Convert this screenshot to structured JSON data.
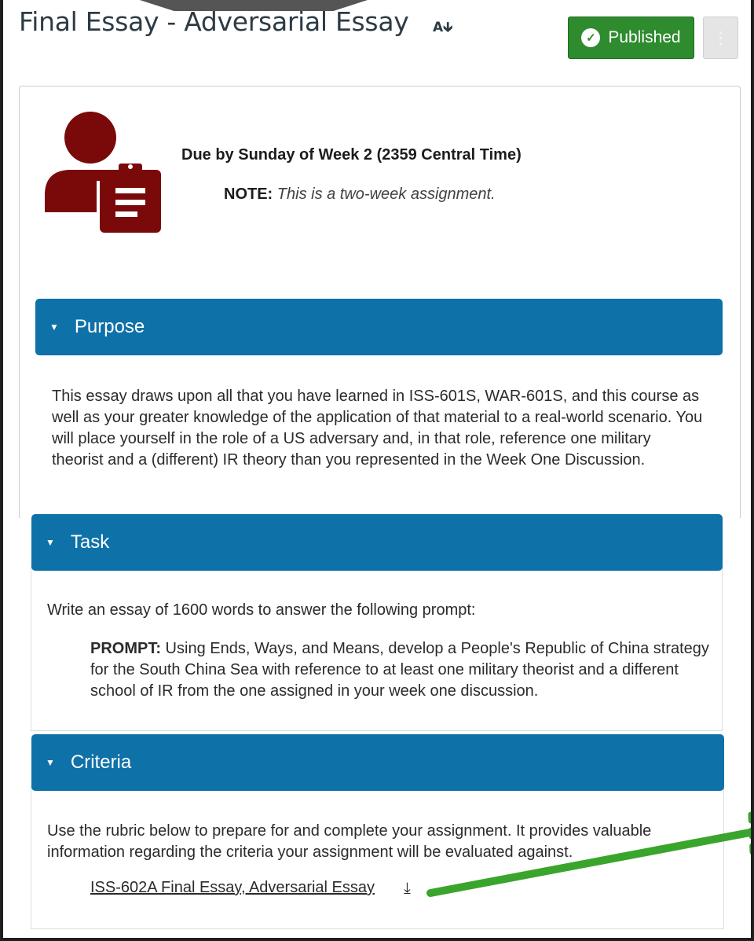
{
  "header": {
    "title": "Final Essay - Adversarial Essay",
    "title_icon": "sort-icon",
    "published_label": "Published"
  },
  "intro": {
    "due": "Due by Sunday of Week 2 (2359 Central Time)",
    "note_label": "NOTE:",
    "note_text": "This is a two-week assignment.",
    "icon": "person-clipboard-icon",
    "icon_color": "#7a0a0a"
  },
  "sections": {
    "purpose": {
      "title": "Purpose",
      "body": "This essay draws upon all that you have learned in ISS-601S, WAR-601S, and this course as well as your greater knowledge of the application of that material to a real-world scenario.  You will place yourself in the role of a US adversary and, in that role, reference one military theorist and a (different) IR theory than you represented in the Week One Discussion."
    },
    "task": {
      "title": "Task",
      "body": "Write an essay of 1600 words to answer the following prompt:",
      "prompt_label": "PROMPT:",
      "prompt_text": " Using Ends, Ways, and Means, develop a People's Republic of China strategy for the South China Sea with reference to at least one military theorist and a different school of IR from the one assigned in your week one discussion."
    },
    "criteria": {
      "title": "Criteria",
      "body": "Use the rubric below to prepare for and complete your assignment. It provides valuable information regarding the criteria your assignment will be evaluated against.",
      "link_label": "ISS-602A Final Essay, Adversarial Essay"
    }
  },
  "colors": {
    "section_header": "#0e71a8",
    "published": "#2e8b2e",
    "annotation_arrow": "#3aa52c"
  }
}
